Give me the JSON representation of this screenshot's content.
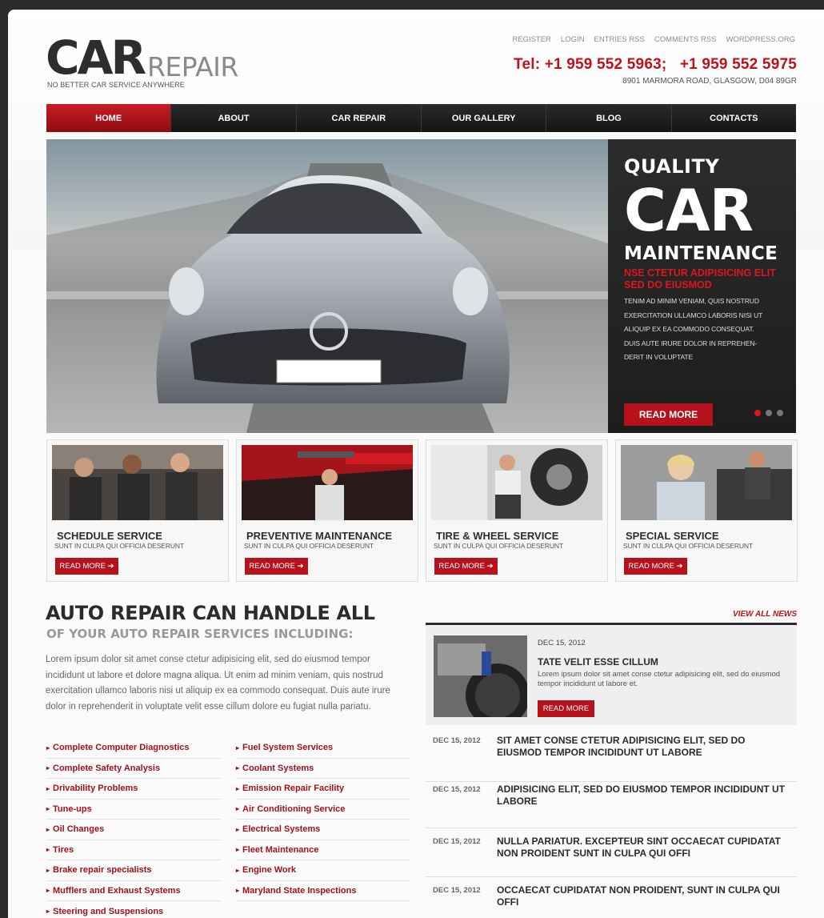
{
  "header": {
    "logo_car": "CAR",
    "logo_repair": "REPAIR",
    "logo_tagline": "NO BETTER CAR SERVICE ANYWHERE",
    "top_links": [
      "REGISTER",
      "LOGIN",
      "ENTRIES RSS",
      "COMMENTS RSS",
      "WORDPRESS.ORG"
    ],
    "phone": "Tel: +1 959 552 5963;   +1 959 552 5975",
    "address": "8901 MARMORA ROAD, GLASGOW,  D04 89GR"
  },
  "nav": {
    "items": [
      "HOME",
      "ABOUT",
      "CAR REPAIR",
      "OUR GALLERY",
      "BLOG",
      "CONTACTS"
    ],
    "active": "HOME"
  },
  "hero": {
    "quality": "QUALITY",
    "car": "CAR",
    "maintenance": "MAINTENANCE",
    "red_line_1": "NSE CTETUR ADIPISICING  ELIT",
    "red_line_2": "SED DO EIUSMOD",
    "text_lines": [
      "TENIM AD MINIM VENIAM, QUIS NOSTRUD",
      "EXERCITATION ULLAMCO LABORIS NISI UT",
      "ALIQUIP EX EA COMMODO CONSEQUAT.",
      "DUIS AUTE IRURE DOLOR IN REPREHEN-",
      "DERIT IN VOLUPTATE"
    ],
    "button": "READ MORE",
    "slides": 3,
    "active_slide": 1
  },
  "services": [
    {
      "title": "SCHEDULE SERVICE",
      "sub": "SUNT IN CULPA QUI OFFICIA DESERUNT",
      "button": "READ MORE"
    },
    {
      "title": "PREVENTIVE MAINTENANCE",
      "sub": "SUNT IN CULPA QUI OFFICIA DESERUNT",
      "button": "READ MORE"
    },
    {
      "title": "TIRE & WHEEL SERVICE",
      "sub": "SUNT IN CULPA QUI OFFICIA DESERUNT",
      "button": "READ MORE"
    },
    {
      "title": "SPECIAL SERVICE",
      "sub": "SUNT IN CULPA QUI OFFICIA DESERUNT",
      "button": "READ MORE"
    }
  ],
  "about": {
    "heading": "AUTO REPAIR CAN HANDLE ALL",
    "subheading": "OF YOUR AUTO REPAIR SERVICES INCLUDING:",
    "paragraph": "Lorem ipsum dolor sit amet conse ctetur adipisicing elit, sed do eiusmod tempor incididunt ut labore et dolore magna aliqua. Ut enim ad minim veniam, quis nostrud exercitation ullamco laboris nisi ut aliquip ex ea commodo consequat. Duis aute irure dolor in reprehenderit in voluptate velit esse cillum dolore eu fugiat nulla pariatu.",
    "list_left": [
      "Complete Computer Diagnostics",
      "Complete Safety Analysis",
      "Drivability Problems",
      "Tune-ups",
      "Oil Changes",
      "Tires",
      "Brake repair specialists",
      "Mufflers and Exhaust Systems",
      "Steering and Suspensions"
    ],
    "list_right": [
      "Fuel System Services",
      "Coolant Systems",
      "Emission Repair Facility",
      "Air Conditioning Service",
      "Electrical Systems",
      "Fleet Maintenance",
      "Engine Work",
      "Maryland State Inspections"
    ]
  },
  "news": {
    "view_all": "VIEW ALL NEWS",
    "featured": {
      "date": "DEC 15, 2012",
      "title": "TATE VELIT ESSE CILLUM",
      "text": "Lorem ipsum dolor sit amet conse ctetur adipisicing elit, sed do eiusmod tempor incididunt ut labore et.",
      "button": "READ MORE"
    },
    "items": [
      {
        "date": "DEC 15, 2012",
        "title": "SIT AMET CONSE CTETUR ADIPISICING ELIT, SED DO EIUSMOD TEMPOR INCIDIDUNT UT LABORE"
      },
      {
        "date": "DEC 15, 2012",
        "title": "ADIPISICING ELIT, SED DO EIUSMOD TEMPOR INCIDIDUNT UT LABORE"
      },
      {
        "date": "DEC 15, 2012",
        "title": "NULLA PARIATUR. EXCEPTEUR SINT OCCAECAT CUPIDATAT NON PROIDENT SUNT IN CULPA QUI OFFI"
      },
      {
        "date": "DEC 15, 2012",
        "title": "OCCAECAT CUPIDATAT NON PROIDENT, SUNT IN CULPA QUI OFFI"
      }
    ]
  },
  "colors": {
    "accent": "#b5121b",
    "dark": "#1e1e1e",
    "phone": "#c0111b"
  }
}
